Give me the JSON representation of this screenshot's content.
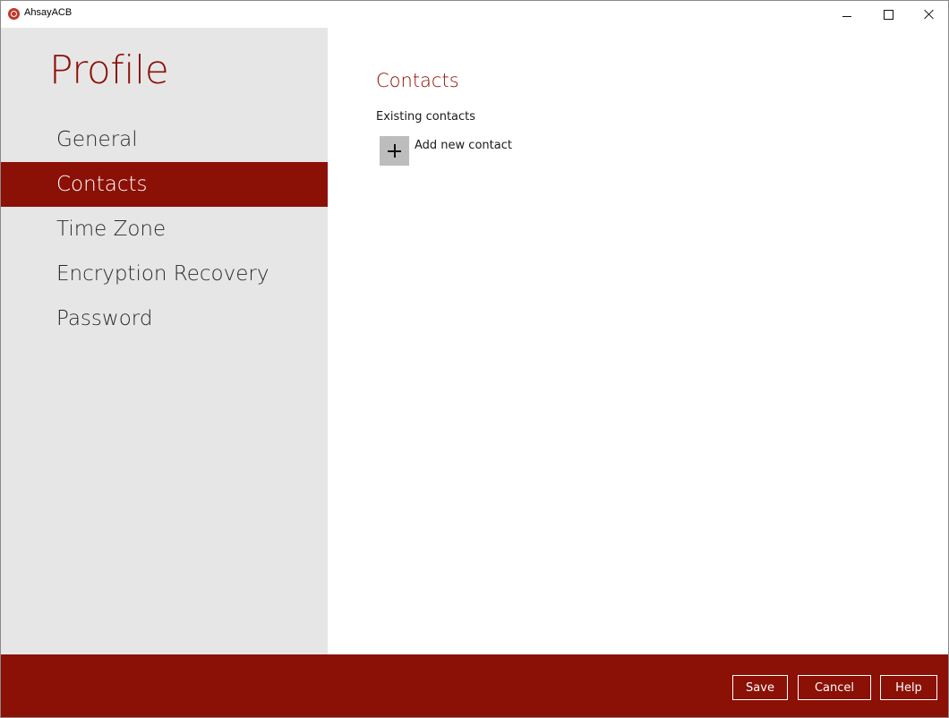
{
  "window": {
    "app_title": "AhsayACB",
    "brand_color": "#8b1006"
  },
  "sidebar": {
    "title": "Profile",
    "items": [
      {
        "label": "General",
        "active": false
      },
      {
        "label": "Contacts",
        "active": true
      },
      {
        "label": "Time Zone",
        "active": false
      },
      {
        "label": "Encryption Recovery",
        "active": false
      },
      {
        "label": "Password",
        "active": false
      }
    ]
  },
  "main": {
    "section_title": "Contacts",
    "existing_label": "Existing contacts",
    "add_contact_label": "Add new contact",
    "add_icon": "plus-icon"
  },
  "footer": {
    "save_label": "Save",
    "cancel_label": "Cancel",
    "help_label": "Help"
  }
}
